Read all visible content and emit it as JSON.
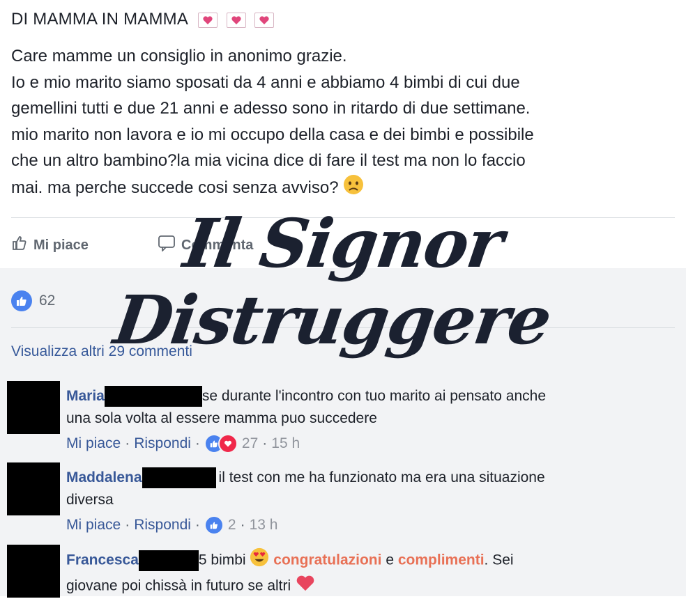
{
  "post": {
    "title": "DI MAMMA IN MAMMA",
    "title_icons": [
      "heart-envelope-icon",
      "heart-envelope-icon",
      "heart-envelope-icon"
    ],
    "body_lines": [
      "Care mamme un consiglio in anonimo grazie.",
      "Io e mio marito siamo sposati da 4 anni e abbiamo 4 bimbi di cui due",
      "gemellini tutti e due 21 anni e adesso sono in ritardo di due settimane.",
      "mio marito non lavora e io mi occupo della casa e dei bimbi e possibile",
      "che un altro bambino?la mia vicina dice di fare il test ma non lo faccio",
      "mai. ma perche succede cosi senza avviso?"
    ],
    "end_icon": "worried-face-icon"
  },
  "actions": {
    "like_label": "Mi piace",
    "comment_label": "Commenta"
  },
  "reactions": {
    "like_count": "62"
  },
  "view_more": "Visualizza altri 29 commenti",
  "watermark": {
    "text": "Il Signor Distruggere"
  },
  "comments": [
    {
      "name": "Maria",
      "text_line1": "se durante l'incontro con tuo marito ai pensato anche",
      "text_line2": "una sola volta al essere mamma puo succedere",
      "like_label": "Mi piace",
      "reply_label": "Rispondi",
      "reaction_count": "27",
      "time": "15 h"
    },
    {
      "name": "Maddalena",
      "text_line1": "il test con me ha funzionato ma era una situazione",
      "text_line2": "diversa",
      "like_label": "Mi piace",
      "reply_label": "Rispondi",
      "reaction_count": "2",
      "time": "13 h"
    },
    {
      "name": "Francesca",
      "text_a": "5 bimbi",
      "text_b": "congratulazioni",
      "text_c": "e",
      "text_d": "complimenti",
      "text_e": ". Sei",
      "text_line2": "giovane poi chissà in futuro se altri"
    }
  ],
  "colors": {
    "link": "#385898",
    "like_blue": "#4a82ef",
    "love_red": "#f0284a",
    "highlight_orange": "#e87055",
    "comments_bg": "#f2f3f5"
  }
}
